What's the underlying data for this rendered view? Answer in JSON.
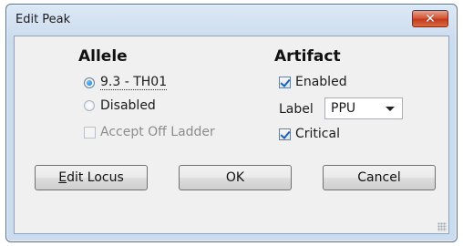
{
  "window": {
    "title": "Edit Peak",
    "close_label": "✕"
  },
  "allele": {
    "heading": "Allele",
    "options": [
      {
        "label": "9.3 - TH01",
        "selected": true
      },
      {
        "label": "Disabled",
        "selected": false
      }
    ],
    "accept_off_ladder": {
      "label": "Accept Off Ladder",
      "checked": false,
      "enabled": false
    }
  },
  "artifact": {
    "heading": "Artifact",
    "enabled": {
      "label": "Enabled",
      "checked": true
    },
    "label_caption": "Label",
    "label_value": "PPU",
    "critical": {
      "label": "Critical",
      "checked": true
    }
  },
  "buttons": {
    "edit_locus_mnemonic": "E",
    "edit_locus_rest": "dit Locus",
    "ok": "OK",
    "cancel": "Cancel"
  }
}
